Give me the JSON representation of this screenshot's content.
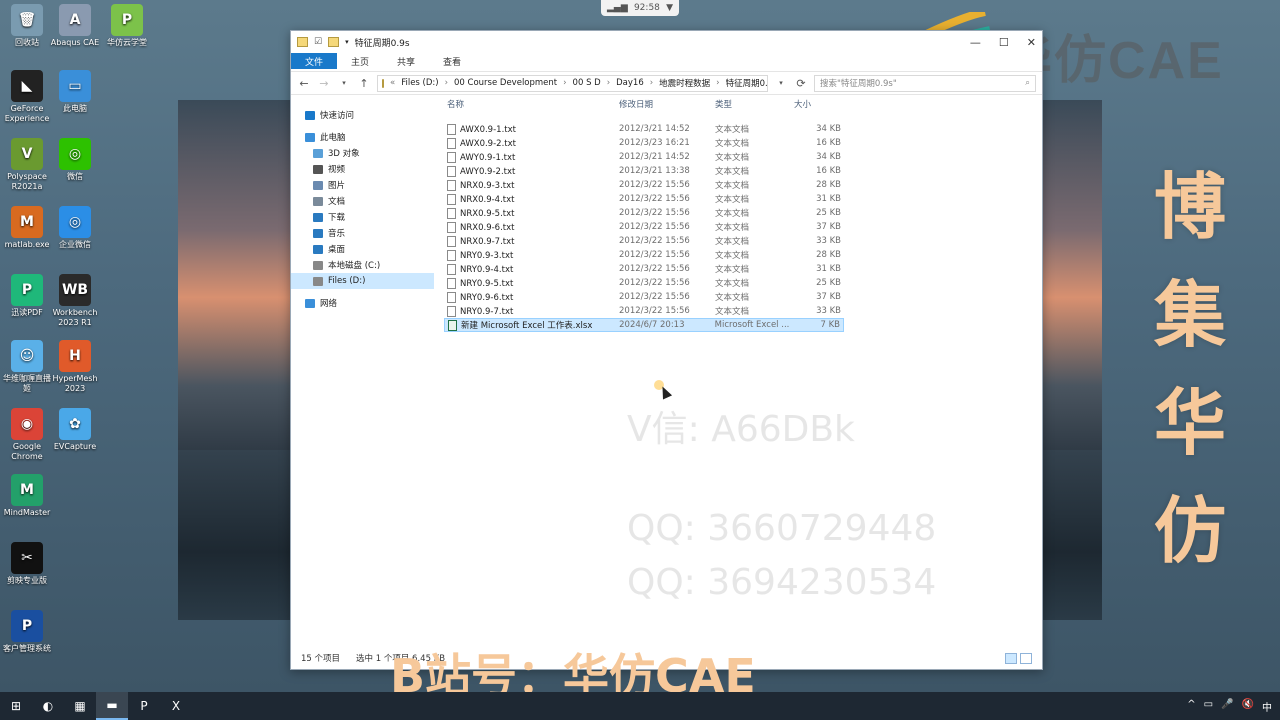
{
  "desktop_icons": [
    {
      "label": "回收站",
      "color": "#7a9bb0",
      "glyph": "🗑"
    },
    {
      "label": "Abaqus CAE",
      "color": "#8a9ab0",
      "glyph": "A"
    },
    {
      "label": "华仿云学堂",
      "color": "#7cc24a",
      "glyph": "P"
    },
    {
      "label": "GeForce Experience",
      "color": "#222222",
      "glyph": "◣"
    },
    {
      "label": "此电脑",
      "color": "#3a8fd9",
      "glyph": "▭"
    },
    {
      "label": "Polyspace R2021a",
      "color": "#6a9a30",
      "glyph": "V"
    },
    {
      "label": "微信",
      "color": "#2dc100",
      "glyph": "◎"
    },
    {
      "label": "matlab.exe",
      "color": "#d86a20",
      "glyph": "M"
    },
    {
      "label": "企业微信",
      "color": "#2b8ee6",
      "glyph": "◎"
    },
    {
      "label": "迅读PDF",
      "color": "#1fb87a",
      "glyph": "P"
    },
    {
      "label": "Workbench 2023 R1",
      "color": "#2a2a2a",
      "glyph": "WB"
    },
    {
      "label": "华维咖喱直播姬",
      "color": "#5ab0e8",
      "glyph": "☺"
    },
    {
      "label": "HyperMesh 2023",
      "color": "#e05a2a",
      "glyph": "H"
    },
    {
      "label": "Google Chrome",
      "color": "#db4437",
      "glyph": "◉"
    },
    {
      "label": "EVCapture",
      "color": "#4aa8e8",
      "glyph": "✿"
    },
    {
      "label": "MindMaster",
      "color": "#23a06a",
      "glyph": "M"
    },
    {
      "label": "剪映专业版",
      "color": "#111111",
      "glyph": "✂"
    },
    {
      "label": "客户管理系统",
      "color": "#1a4fa0",
      "glyph": "P"
    }
  ],
  "topbar": {
    "time": "92:58"
  },
  "brand": {
    "text": "华仿CAE"
  },
  "side_text": [
    "博",
    "集",
    "华",
    "仿"
  ],
  "window": {
    "title": "特征周期0.9s",
    "controls": {
      "minimize": "—",
      "maximize": "☐",
      "close": "✕"
    },
    "ribbon_tabs": [
      "文件",
      "主页",
      "共享",
      "查看"
    ],
    "address": [
      "Files (D:)",
      "00 Course Development",
      "00 S D",
      "Day16",
      "地震时程数据",
      "特征周期0.9s"
    ],
    "search_placeholder": "搜索\"特征周期0.9s\"",
    "nav_pane": [
      {
        "label": "快速访问",
        "color": "#1979ca"
      },
      {
        "label": "此电脑",
        "color": "#3a8fd9"
      },
      {
        "label": "3D 对象",
        "color": "#5aa0d8"
      },
      {
        "label": "视频",
        "color": "#555555"
      },
      {
        "label": "图片",
        "color": "#6a8ab0"
      },
      {
        "label": "文档",
        "color": "#7a8a9a"
      },
      {
        "label": "下载",
        "color": "#2a7ac0"
      },
      {
        "label": "音乐",
        "color": "#2a7ac0"
      },
      {
        "label": "桌面",
        "color": "#2a7ac0"
      },
      {
        "label": "本地磁盘 (C:)",
        "color": "#888888"
      },
      {
        "label": "Files (D:)",
        "color": "#888888"
      },
      {
        "label": "网络",
        "color": "#3a8fd9"
      }
    ],
    "columns": {
      "name": "名称",
      "date": "修改日期",
      "type": "类型",
      "size": "大小"
    },
    "files": [
      {
        "name": "AWX0.9-1.txt",
        "date": "2012/3/21 14:52",
        "type": "文本文档",
        "size": "34 KB"
      },
      {
        "name": "AWX0.9-2.txt",
        "date": "2012/3/23 16:21",
        "type": "文本文档",
        "size": "16 KB"
      },
      {
        "name": "AWY0.9-1.txt",
        "date": "2012/3/21 14:52",
        "type": "文本文档",
        "size": "34 KB"
      },
      {
        "name": "AWY0.9-2.txt",
        "date": "2012/3/21 13:38",
        "type": "文本文档",
        "size": "16 KB"
      },
      {
        "name": "NRX0.9-3.txt",
        "date": "2012/3/22 15:56",
        "type": "文本文档",
        "size": "28 KB"
      },
      {
        "name": "NRX0.9-4.txt",
        "date": "2012/3/22 15:56",
        "type": "文本文档",
        "size": "31 KB"
      },
      {
        "name": "NRX0.9-5.txt",
        "date": "2012/3/22 15:56",
        "type": "文本文档",
        "size": "25 KB"
      },
      {
        "name": "NRX0.9-6.txt",
        "date": "2012/3/22 15:56",
        "type": "文本文档",
        "size": "37 KB"
      },
      {
        "name": "NRX0.9-7.txt",
        "date": "2012/3/22 15:56",
        "type": "文本文档",
        "size": "33 KB"
      },
      {
        "name": "NRY0.9-3.txt",
        "date": "2012/3/22 15:56",
        "type": "文本文档",
        "size": "28 KB"
      },
      {
        "name": "NRY0.9-4.txt",
        "date": "2012/3/22 15:56",
        "type": "文本文档",
        "size": "31 KB"
      },
      {
        "name": "NRY0.9-5.txt",
        "date": "2012/3/22 15:56",
        "type": "文本文档",
        "size": "25 KB"
      },
      {
        "name": "NRY0.9-6.txt",
        "date": "2012/3/22 15:56",
        "type": "文本文档",
        "size": "37 KB"
      },
      {
        "name": "NRY0.9-7.txt",
        "date": "2012/3/22 15:56",
        "type": "文本文档",
        "size": "33 KB"
      },
      {
        "name": "新建 Microsoft Excel 工作表.xlsx",
        "date": "2024/6/7 20:13",
        "type": "Microsoft Excel ...",
        "size": "7 KB",
        "selected": true
      }
    ],
    "status": {
      "count": "15 个项目",
      "selected": "选中 1 个项目  6.45 KB"
    }
  },
  "watermarks": {
    "line1": "V信: A66DBk",
    "line2": "QQ: 3660729448",
    "line3": "QQ: 3694230534",
    "bottom": "B站号：华仿CAE"
  },
  "taskbar": {
    "items": [
      "⊞",
      "◐",
      "▦",
      "▬",
      "P",
      "X"
    ],
    "tray": [
      "^",
      "▭",
      "🎤",
      "🔇",
      "中"
    ]
  }
}
